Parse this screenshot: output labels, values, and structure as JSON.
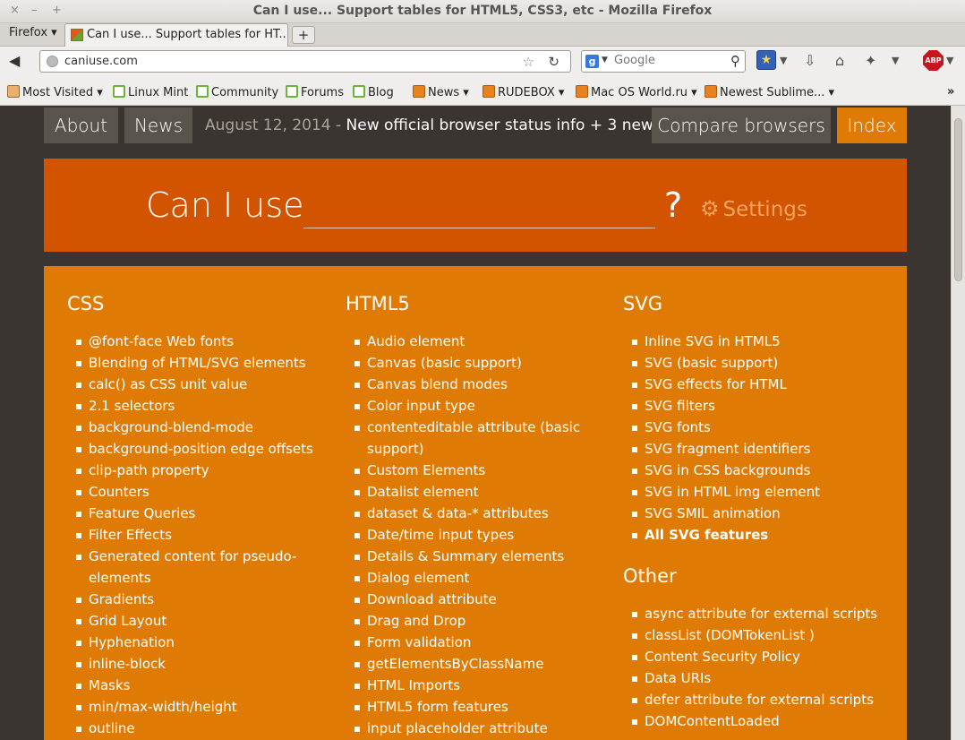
{
  "window": {
    "title": "Can I use... Support tables for HTML5, CSS3, etc - Mozilla Firefox",
    "buttons": [
      "×",
      "–",
      "+"
    ]
  },
  "tabs": {
    "menu_label": "Firefox ▾",
    "active_tab": "Can I use... Support tables for HT...",
    "new_tab": "+"
  },
  "navbar": {
    "url": "caniuse.com",
    "search_placeholder": "Google"
  },
  "bookmarks": [
    {
      "label": "Most Visited ▾",
      "icon": "most-visited"
    },
    {
      "label": "Linux Mint",
      "icon": "mint"
    },
    {
      "label": "Community",
      "icon": "mint"
    },
    {
      "label": "Forums",
      "icon": "mint"
    },
    {
      "label": "Blog",
      "icon": "mint"
    },
    {
      "label": "News ▾",
      "icon": "rss"
    },
    {
      "label": "RUDEBOX ▾",
      "icon": "rss"
    },
    {
      "label": "Mac OS World.ru ▾",
      "icon": "rss"
    },
    {
      "label": "Newest Sublime... ▾",
      "icon": "rss"
    }
  ],
  "page": {
    "nav": {
      "about": "About",
      "news": "News",
      "news_date": "August 12, 2014 - ",
      "news_text": "New official browser status info + 3 new...",
      "compare": "Compare browsers",
      "index": "Index"
    },
    "search": {
      "label": "Can I use",
      "qmark": "?",
      "settings": "Settings"
    },
    "columns": {
      "css": {
        "title": "CSS",
        "items": [
          "@font-face Web fonts",
          "Blending of HTML/SVG elements",
          "calc() as CSS unit value",
          "2.1 selectors",
          "background-blend-mode",
          "background-position edge offsets",
          "clip-path property",
          "Counters",
          "Feature Queries",
          "Filter Effects",
          "Generated content for pseudo-elements",
          "Gradients",
          "Grid Layout",
          "Hyphenation",
          "inline-block",
          "Masks",
          "min/max-width/height",
          "outline"
        ]
      },
      "html5": {
        "title": "HTML5",
        "items": [
          "Audio element",
          "Canvas (basic support)",
          "Canvas blend modes",
          "Color input type",
          "contenteditable attribute (basic support)",
          "Custom Elements",
          "Datalist element",
          "dataset & data-* attributes",
          "Date/time input types",
          "Details & Summary elements",
          "Dialog element",
          "Download attribute",
          "Drag and Drop",
          "Form validation",
          "getElementsByClassName",
          "HTML Imports",
          "HTML5 form features",
          "input placeholder attribute"
        ]
      },
      "svg": {
        "title": "SVG",
        "items": [
          "Inline SVG in HTML5",
          "SVG (basic support)",
          "SVG effects for HTML",
          "SVG filters",
          "SVG fonts",
          "SVG fragment identifiers",
          "SVG in CSS backgrounds",
          "SVG in HTML img element",
          "SVG SMIL animation"
        ],
        "all_link": "All SVG features"
      },
      "other": {
        "title": "Other",
        "items": [
          "async attribute for external scripts",
          "classList (DOMTokenList )",
          "Content Security Policy",
          "Data URIs",
          "defer attribute for external scripts",
          "DOMContentLoaded"
        ]
      }
    }
  },
  "colors": {
    "page_bg": "#3a3530",
    "nav_button": "#5a544e",
    "index_active": "#df7b04",
    "search_panel": "#d35400",
    "index_panel": "#df7b04"
  }
}
